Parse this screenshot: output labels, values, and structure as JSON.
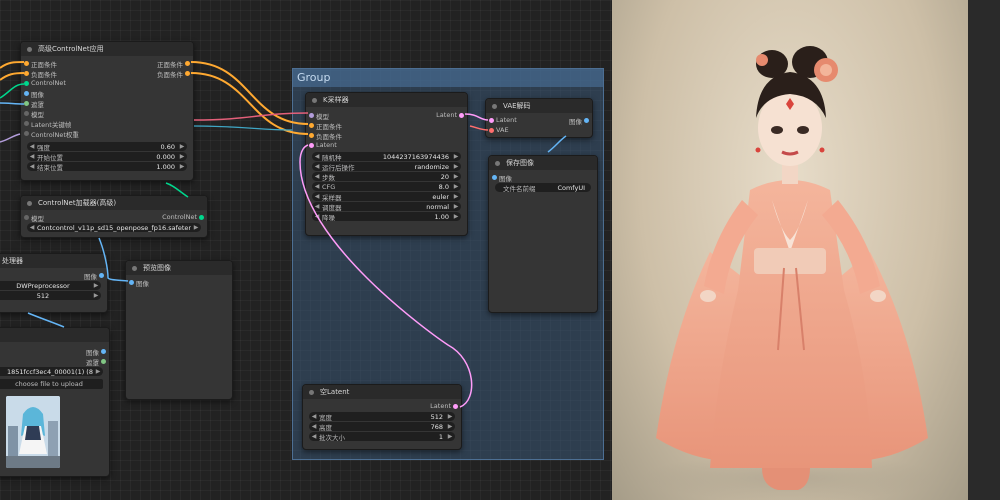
{
  "group": {
    "title": "Group"
  },
  "controlnet_apply": {
    "title": "高级ControlNet应用",
    "inputs": [
      "正面条件",
      "负面条件",
      "ControlNet",
      "图像",
      "遮罩",
      "模型",
      "Latent关键帧",
      "ControlNet权重"
    ],
    "outputs": [
      "正面条件",
      "负面条件"
    ],
    "widgets": [
      {
        "label": "强度",
        "value": "0.60"
      },
      {
        "label": "开始位置",
        "value": "0.000"
      },
      {
        "label": "结束位置",
        "value": "1.000"
      }
    ]
  },
  "controlnet_loader": {
    "title": "ControlNet加载器(高级)",
    "input": "模型",
    "output": "ControlNet",
    "widget_value": "Contcontrol_v11p_sd15_openpose_fp16.safetensors"
  },
  "preprocessor": {
    "title": "处理器",
    "output": "图像",
    "widgets": [
      {
        "value": "DWPreprocessor"
      },
      {
        "value": "512"
      }
    ]
  },
  "load_image": {
    "outputs": [
      "图像",
      "遮罩"
    ],
    "filename": "1851fccf3ec4_00001(1) (8).jpg",
    "upload_label": "choose file to upload"
  },
  "preview_image": {
    "title": "预览图像",
    "input": "图像"
  },
  "ksampler": {
    "title": "K采样器",
    "inputs": [
      "模型",
      "正面条件",
      "负面条件",
      "Latent"
    ],
    "output": "Latent",
    "widgets": [
      {
        "label": "随机种",
        "value": "1044237163974436"
      },
      {
        "label": "运行后操作",
        "value": "randomize"
      },
      {
        "label": "步数",
        "value": "20"
      },
      {
        "label": "CFG",
        "value": "8.0"
      },
      {
        "label": "采样器",
        "value": "euler"
      },
      {
        "label": "调度器",
        "value": "normal"
      },
      {
        "label": "降噪",
        "value": "1.00"
      }
    ]
  },
  "vae_decode": {
    "title": "VAE解码",
    "inputs": [
      "Latent",
      "VAE"
    ],
    "output": "图像"
  },
  "save_image": {
    "title": "保存图像",
    "input": "图像",
    "prefix_label": "文件名前缀",
    "prefix_value": "ComfyUI"
  },
  "empty_latent": {
    "title": "空Latent",
    "output": "Latent",
    "widgets": [
      {
        "label": "宽度",
        "value": "512"
      },
      {
        "label": "高度",
        "value": "768"
      },
      {
        "label": "批次大小",
        "value": "1"
      }
    ]
  },
  "colors": {
    "conditioning": "#ffa931",
    "model": "#b39ddb",
    "latent": "#ff9cf9",
    "vae": "#ff6e6e",
    "image": "#64b5f6",
    "controlnet": "#00d78d",
    "mask": "#81c784"
  }
}
